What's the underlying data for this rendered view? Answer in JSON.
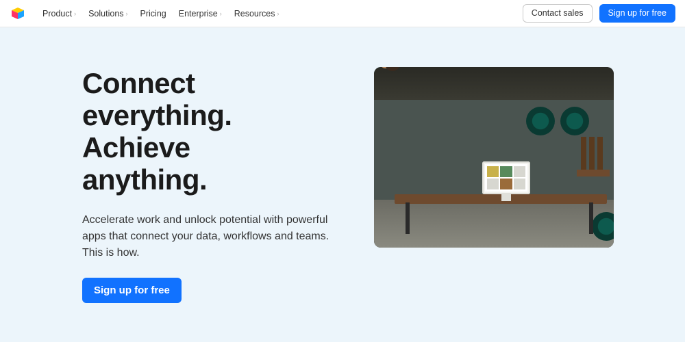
{
  "nav": {
    "items": [
      {
        "label": "Product",
        "has_dropdown": true
      },
      {
        "label": "Solutions",
        "has_dropdown": true
      },
      {
        "label": "Pricing",
        "has_dropdown": false
      },
      {
        "label": "Enterprise",
        "has_dropdown": true
      },
      {
        "label": "Resources",
        "has_dropdown": true
      }
    ],
    "contact_label": "Contact sales",
    "signup_label": "Sign up for free"
  },
  "hero": {
    "headline": "Connect\neverything.\nAchieve\nanything.",
    "subhead": "Accelerate work and unlock potential with powerful apps that connect your data, workflows and teams. This is how.",
    "cta_label": "Sign up for free"
  },
  "colors": {
    "primary": "#1172ff",
    "hero_bg": "#ecf5fb"
  }
}
